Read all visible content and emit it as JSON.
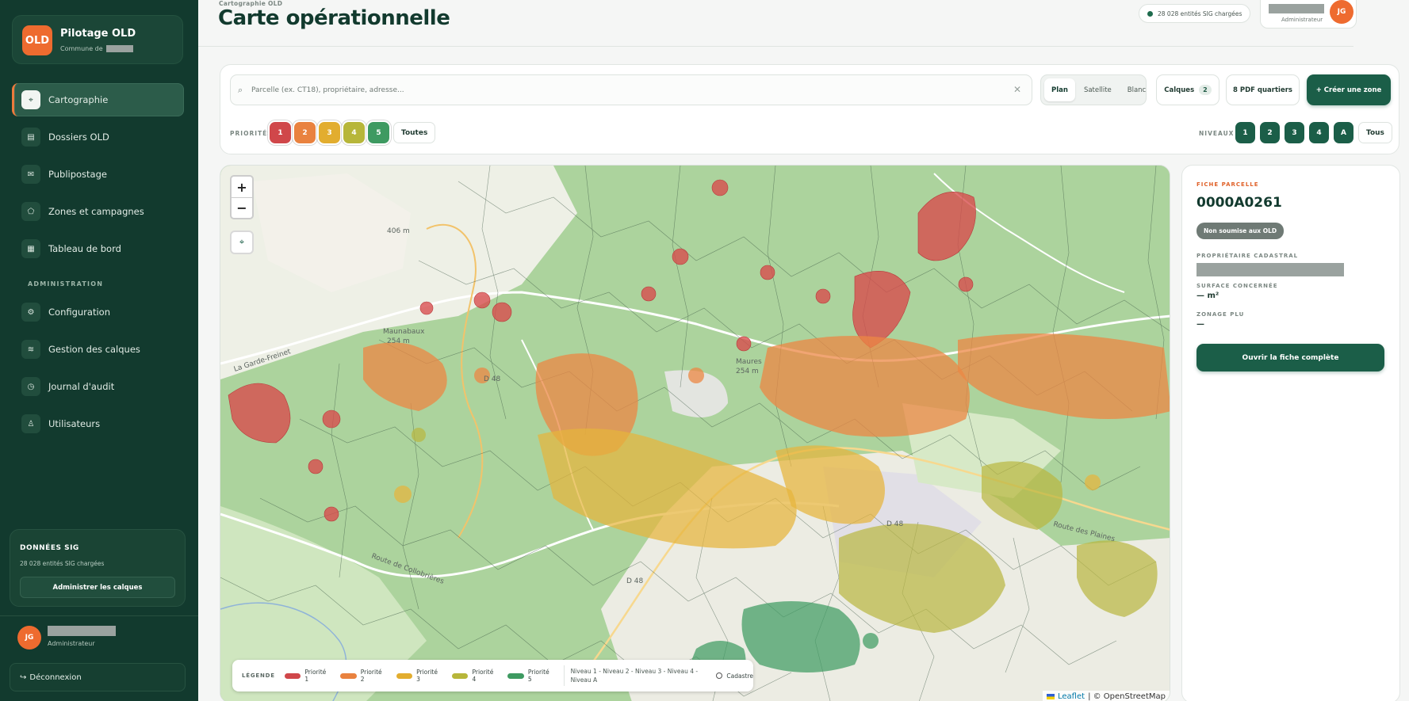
{
  "app": {
    "logo_text": "OLD",
    "name": "Pilotage OLD",
    "commune_label": "Commune de"
  },
  "sidebar": {
    "items": [
      {
        "label": "Cartographie",
        "icon": "map-pin-icon",
        "active": true
      },
      {
        "label": "Dossiers OLD",
        "icon": "folder-icon",
        "active": false
      },
      {
        "label": "Publipostage",
        "icon": "mail-icon",
        "active": false
      },
      {
        "label": "Zones et campagnes",
        "icon": "zone-icon",
        "active": false
      },
      {
        "label": "Tableau de bord",
        "icon": "dashboard-icon",
        "active": false
      }
    ],
    "admin_section": "ADMINISTRATION",
    "admin_items": [
      {
        "label": "Configuration",
        "icon": "gear-icon"
      },
      {
        "label": "Gestion des calques",
        "icon": "layers-icon"
      },
      {
        "label": "Journal d'audit",
        "icon": "clock-icon"
      },
      {
        "label": "Utilisateurs",
        "icon": "user-icon"
      }
    ],
    "sig": {
      "title": "DONNÉES SIG",
      "text": "28 028 entités SIG chargées",
      "button": "Administrer les calques"
    },
    "user": {
      "initials": "JG",
      "role": "Administrateur"
    },
    "logout": "Déconnexion"
  },
  "header": {
    "breadcrumb": "Cartographie OLD",
    "title": "Carte opérationnelle",
    "sig_status": "28 028 entités SIG chargées",
    "user_role": "Administrateur",
    "user_initials": "JG"
  },
  "toolbar": {
    "search_placeholder": "Parcelle (ex. CT18), propriétaire, adresse...",
    "basemaps": [
      "Plan",
      "Satellite",
      "Blanc"
    ],
    "basemap_active": "Plan",
    "layers_label": "Calques",
    "layers_count": "2",
    "pdf_label": "8 PDF quartiers",
    "create_zone": "+ Créer une zone",
    "priorities_label": "PRIORITÉS",
    "priorities": [
      {
        "label": "1",
        "color": "#d0474a"
      },
      {
        "label": "2",
        "color": "#e9823f"
      },
      {
        "label": "3",
        "color": "#e2ad2f"
      },
      {
        "label": "4",
        "color": "#b7b63a"
      },
      {
        "label": "5",
        "color": "#3e9a61"
      }
    ],
    "priorities_all": "Toutes",
    "levels_label": "NIVEAUX",
    "levels": [
      "1",
      "2",
      "3",
      "4",
      "A"
    ],
    "levels_all": "Tous"
  },
  "map": {
    "zoom_in": "+",
    "zoom_out": "−",
    "place_labels": [
      "406 m",
      "La Garde-Freinet",
      "Maunabaux",
      "254 m",
      "Maures",
      "254 m",
      "D 48",
      "Route de Collobrières",
      "D 48",
      "Route des Plaines",
      "D 48"
    ],
    "legend": {
      "title": "LÉGENDE",
      "items": [
        {
          "label": "Priorité 1",
          "color": "#d0474a"
        },
        {
          "label": "Priorité 2",
          "color": "#e9823f"
        },
        {
          "label": "Priorité 3",
          "color": "#e2ad2f"
        },
        {
          "label": "Priorité 4",
          "color": "#b7b63a"
        },
        {
          "label": "Priorité 5",
          "color": "#3e9a61"
        }
      ],
      "levels_text": "Niveau 1 - Niveau 2 - Niveau 3 - Niveau 4 - Niveau A",
      "cadastre": "Cadastre"
    },
    "attribution_leaflet": "Leaflet",
    "attribution_osm": "| © OpenStreetMap"
  },
  "parcel": {
    "section_label": "FICHE PARCELLE",
    "id": "0000A0261",
    "status": "Non soumise aux OLD",
    "owner_label": "PROPRIÉTAIRE CADASTRAL",
    "surface_label": "SURFACE CONCERNÉE",
    "surface_value": "— m²",
    "zoning_label": "ZONAGE PLU",
    "zoning_value": "—",
    "open_button": "Ouvrir la fiche complète"
  }
}
